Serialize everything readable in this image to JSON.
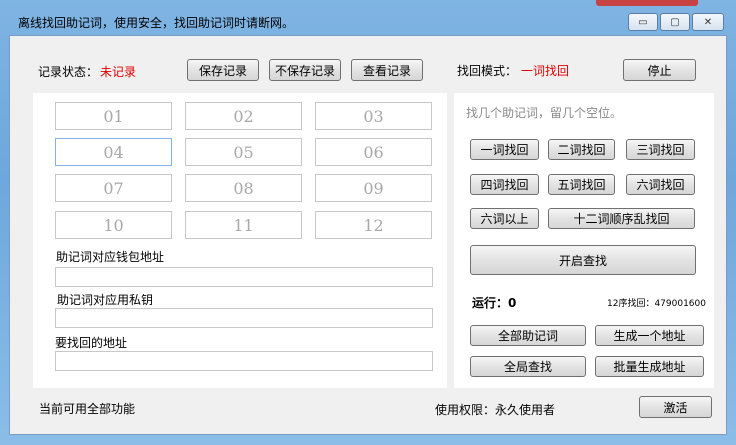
{
  "window": {
    "title": "离线找回助记词，使用安全，找回助记词时请断网。"
  },
  "caption": {
    "minimize_glyph": "▭",
    "maximize_glyph": "▢",
    "close_glyph": "✕"
  },
  "top_bar": {
    "status_label": "记录状态：",
    "status_value": "未记录",
    "save_label": "保存记录",
    "nosave_label": "不保存记录",
    "view_label": "查看记录",
    "mode_label": "找回模式：",
    "mode_value": "一词找回",
    "stop_label": "停止"
  },
  "words": [
    "01",
    "02",
    "03",
    "04",
    "05",
    "06",
    "07",
    "08",
    "09",
    "10",
    "11",
    "12"
  ],
  "fields": {
    "wallet_label": "助记词对应钱包地址",
    "wallet_value": "",
    "privkey_label": "助记词对应用私钥",
    "privkey_value": "",
    "target_label": "要找回的地址",
    "target_value": ""
  },
  "right_panel": {
    "hint": "找几个助记词，留几个空位。",
    "mode_buttons": [
      "一词找回",
      "二词找回",
      "三词找回",
      "四词找回",
      "五词找回",
      "六词找回",
      "六词以上",
      "十二词顺序乱找回"
    ],
    "start_label": "开启查找",
    "running_label": "运行：",
    "running_value": "0",
    "order_label": "12序找回：",
    "order_value": "479001600",
    "all_words_label": "全部助记词",
    "gen_one_label": "生成一个地址",
    "global_search_label": "全局查找",
    "batch_gen_label": "批量生成地址"
  },
  "footer": {
    "features_text": "当前可用全部功能",
    "license_label": "使用权限：",
    "license_value": "永久使用者",
    "activate_label": "激活"
  },
  "colors": {
    "accent_red": "#e00000",
    "frame_blue": "#6ea7dd",
    "client_bg": "#f0f0f0"
  }
}
